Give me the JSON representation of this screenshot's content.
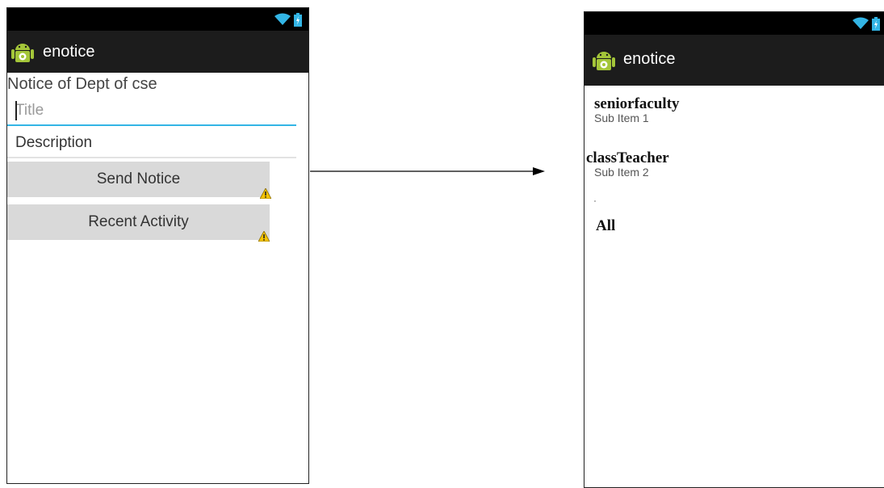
{
  "app": {
    "title": "enotice"
  },
  "left_screen": {
    "heading": "Notice of Dept of cse",
    "title_field": {
      "placeholder": "Title",
      "value": ""
    },
    "description_field": {
      "placeholder": "Description",
      "value": ""
    },
    "buttons": {
      "send": "Send Notice",
      "recent": "Recent Activity"
    }
  },
  "right_screen": {
    "items": [
      {
        "title": "seniorfaculty",
        "subtitle": "Sub Item 1"
      },
      {
        "title": "classTeacher",
        "subtitle": "Sub Item 2"
      },
      {
        "title": "All"
      }
    ]
  },
  "colors": {
    "status_bar": "#000000",
    "action_bar": "#1c1c1c",
    "status_icon": "#33b5e5",
    "focus_underline": "#33b5e5",
    "button_bg": "#d9d9d9",
    "android_green": "#a4c639",
    "warning": "#f5c400"
  },
  "icons": [
    "wifi-icon",
    "battery-icon",
    "android-app-icon",
    "warning-icon",
    "arrow-right-icon"
  ]
}
